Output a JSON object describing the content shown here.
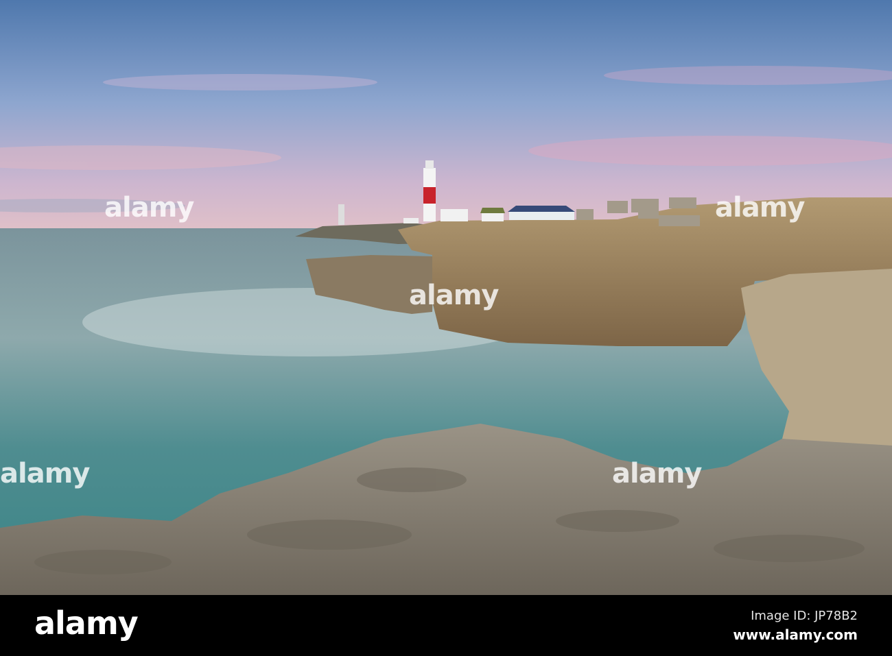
{
  "photo": {
    "subject": "Lighthouse on rocky coastline at dusk",
    "watermark": "alamy"
  },
  "footer": {
    "logo": "alamy",
    "image_id": "Image ID: JP78B2",
    "website": "www.alamy.com"
  },
  "colors": {
    "sky_top": "#4f78ad",
    "sky_horizon": "#d8b5c6",
    "sea": "#4a8b8e",
    "cliff": "#a08660",
    "rock": "#8a8377",
    "lighthouse_red": "#c8232b"
  }
}
